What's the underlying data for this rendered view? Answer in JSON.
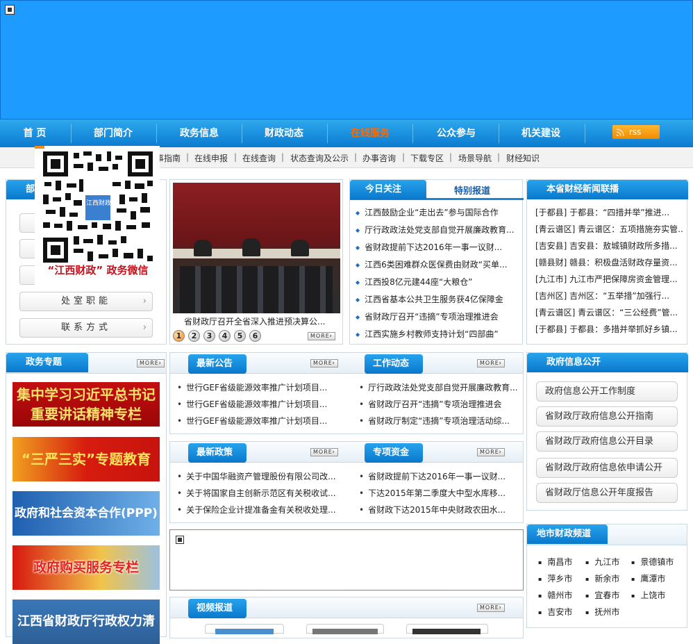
{
  "nav": {
    "items": [
      "首 页",
      "部门简介",
      "政务信息",
      "财政动态",
      "在线服务",
      "公众参与",
      "机关建设"
    ],
    "active_index": 4,
    "rss_label": "rss"
  },
  "subnav": {
    "items": [
      "办事指南",
      "在线申报",
      "在线查询",
      "状态查询及公示",
      "办事咨询",
      "下载专区",
      "场景导航",
      "财经知识"
    ],
    "separator": "|"
  },
  "sidebar": {
    "title": "部",
    "buttons": [
      "处室职能",
      "联系方式"
    ]
  },
  "qr_popup": {
    "logo_text": "江西财政",
    "caption": "“江西财政” 政务微信"
  },
  "slideshow": {
    "caption": "省财政厅召开全省深入推进预决算公...",
    "numbers": [
      "1",
      "2",
      "3",
      "4",
      "5",
      "6"
    ],
    "active": 0,
    "more": "MORE"
  },
  "focus": {
    "tab_active": "今日关注",
    "tab_other": "特别报道",
    "items": [
      "江西鼓励企业“走出去”参与国际合作",
      "厅行政政法处党支部自觉开展廉政教育...",
      "省财政提前下达2016年一事一议财...",
      "江西6类困难群众医保费由财政“买单...",
      "江西投8亿元建44座“大粮仓”",
      "江西省基本公共卫生服务获4亿保障金",
      "省财政厅召开“违摘”专项治理推进会",
      "江西实施乡村教师支持计划“四部曲”"
    ]
  },
  "county_news": {
    "title": "本省财经新闻联播",
    "items": [
      "[于都县]  于都县：“四措并举”推进...",
      "[青云谱区]  青云谱区：五项措施夯实管...",
      "[吉安县]  吉安县：敖城镇财政所多措...",
      "[赣县财]  赣县：积极盘活财政存量资...",
      "[九江市]  九江市严把保障房资金管理...",
      "[吉州区]  吉州区：“五举措”加强行...",
      "[青云谱区]  青云谱区：“三公经费”管...",
      "[于都县]  于都县：多措并举抓好乡镇..."
    ]
  },
  "topics": {
    "title": "政务专题",
    "more": "MORE",
    "banners": [
      "集中学习习近平总书记重要讲话精神专栏",
      "“三严三实”专题教育",
      "政府和社会资本合作(PPP)",
      "政府购买服务专栏",
      "江西省财政厅行政权力清单"
    ]
  },
  "announce": {
    "tab1": "最新公告",
    "tab2": "工作动态",
    "more": "MORE",
    "left": [
      "世行GEF省级能源效率推广计划项目...",
      "世行GEF省级能源效率推广计划项目...",
      "世行GEF省级能源效率推广计划项目..."
    ],
    "right": [
      "厅行政政法处党支部自觉开展廉政教育...",
      "省财政厅召开“违摘”专项治理推进会",
      "省财政厅制定“违摘”专项治理活动综..."
    ]
  },
  "policy": {
    "tab1": "最新政策",
    "tab2": "专项资金",
    "more": "MORE",
    "left": [
      "关于中国华融资产管理股份有限公司改...",
      "关于将国家自主创新示范区有关税收试...",
      "关于保险企业计提准备金有关税收处理..."
    ],
    "right": [
      "省财政提前下达2016年一事一议财...",
      "下达2015年第二季度大中型水库移...",
      "省财政下达2015年中央财政农田水..."
    ]
  },
  "video": {
    "title": "视频报道",
    "more": "MORE"
  },
  "gov_info": {
    "title": "政府信息公开",
    "buttons": [
      "政府信息公开工作制度",
      "省财政厅政府信息公开指南",
      "省财政厅政府信息公开目录",
      "省财政厅政府信息依申请公开",
      "省财政厅信息公开年度报告"
    ]
  },
  "city_channel": {
    "title": "地市财政频道",
    "cities": [
      "南昌市",
      "九江市",
      "景德镇市",
      "萍乡市",
      "新余市",
      "鹰潭市",
      "赣州市",
      "宜春市",
      "上饶市",
      "吉安市",
      "抚州市"
    ]
  },
  "colors": {
    "nav_blue": "#0b7bd0",
    "active_nav": "#ff6a00",
    "banner": "#1e9bff"
  }
}
